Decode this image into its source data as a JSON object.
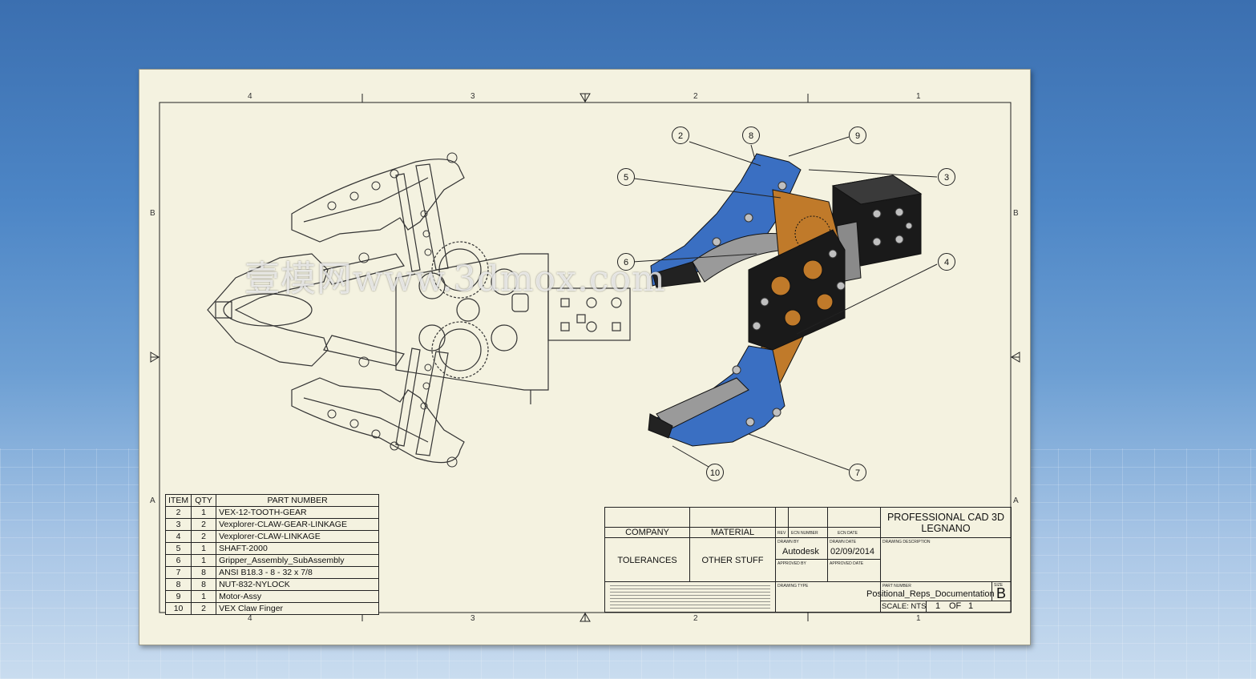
{
  "zones": {
    "columns": [
      "4",
      "3",
      "2",
      "1"
    ],
    "rows": [
      "B",
      "A"
    ]
  },
  "bom": {
    "headers": [
      "ITEM",
      "QTY",
      "PART NUMBER"
    ],
    "rows": [
      [
        "2",
        "1",
        "VEX-12-TOOTH-GEAR"
      ],
      [
        "3",
        "2",
        "Vexplorer-CLAW-GEAR-LINKAGE"
      ],
      [
        "4",
        "2",
        "Vexplorer-CLAW-LINKAGE"
      ],
      [
        "5",
        "1",
        "SHAFT-2000"
      ],
      [
        "6",
        "1",
        "Gripper_Assembly_SubAssembly"
      ],
      [
        "7",
        "8",
        "ANSI B18.3 - 8 - 32 x 7/8"
      ],
      [
        "8",
        "8",
        "NUT-832-NYLOCK"
      ],
      [
        "9",
        "1",
        "Motor-Assy"
      ],
      [
        "10",
        "2",
        "VEX Claw Finger"
      ]
    ]
  },
  "title_block": {
    "company_label": "COMPANY",
    "material_label": "MATERIAL",
    "tolerances": "TOLERANCES",
    "other": "OTHER STUFF",
    "rev_label": "REV",
    "ecn_number_label": "ECN NUMBER",
    "ecn_date_label": "ECN DATE",
    "drawn_by_label": "DRAWN BY",
    "drawn_by": "Autodesk",
    "drawn_date_label": "DRAWN DATE",
    "drawn_date": "02/09/2014",
    "approved_by_label": "APPROVED BY",
    "approved_date_label": "APPROVED DATE",
    "drawing_type_label": "DRAWING TYPE",
    "company_name_line1": "PROFESSIONAL CAD 3D",
    "company_name_line2": "LEGNANO",
    "drawing_description_label": "DRAWING DESCRIPTION",
    "part_number_label": "PART NUMBER",
    "part_number": "Positional_Reps_Documentation",
    "size_label": "SIZE",
    "size": "B",
    "scale": "SCALE: NTS",
    "sheet": "1",
    "of_label": "OF",
    "sheet_total": "1"
  },
  "balloons": [
    "2",
    "8",
    "9",
    "3",
    "5",
    "6",
    "4",
    "10",
    "7"
  ],
  "watermark": "壹模网www.3dmox.com",
  "colors": {
    "background_top": "#3b6fb0",
    "sheet": "#f4f2e0",
    "claw_blue": "#3a6fc2",
    "gear_orange": "#c07a2a",
    "plate_black": "#1a1a1a"
  }
}
